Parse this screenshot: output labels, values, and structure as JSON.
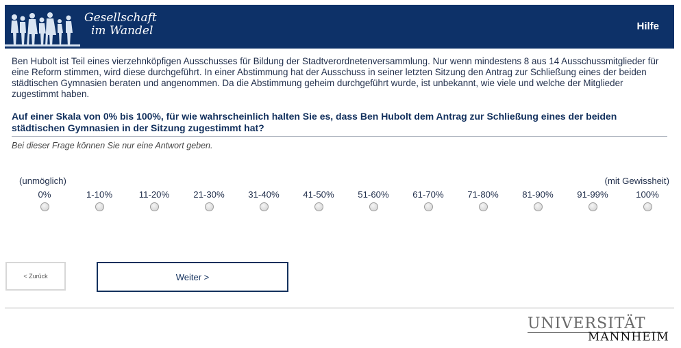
{
  "header": {
    "logo_title_line1": "Gesellschaft",
    "logo_title_line2": "im Wandel",
    "help_label": "Hilfe",
    "bg_color": "#0d3168"
  },
  "intro_text": "Ben Hubolt ist Teil eines vierzehnköpfigen Ausschusses für Bildung der Stadtverordnetenversammlung. Nur wenn mindestens 8 aus 14 Ausschussmitglieder für eine Reform stimmen, wird diese durchgeführt. In einer Abstimmung hat der Ausschuss in seiner letzten Sitzung den Antrag zur Schließung eines der beiden städtischen Gymnasien beraten und angenommen. Da die Abstimmung geheim durchgeführt wurde, ist unbekannt, wie viele und welche der Mitglieder zugestimmt haben.",
  "question": "Auf einer Skala von 0% bis 100%, für wie wahrscheinlich halten Sie es, dass Ben Hubolt dem Antrag zur Schließung eines der beiden städtischen Gymnasien in der Sitzung zugestimmt hat?",
  "hint": "Bei dieser Frage können Sie nur eine Antwort geben.",
  "scale": {
    "anchor_left": "(unmöglich)",
    "anchor_right": "(mit Gewissheit)",
    "options": [
      "0%",
      "1-10%",
      "11-20%",
      "21-30%",
      "31-40%",
      "41-50%",
      "51-60%",
      "61-70%",
      "71-80%",
      "81-90%",
      "91-99%",
      "100%"
    ]
  },
  "nav": {
    "back_label": "< Zurück",
    "next_label": "Weiter >"
  },
  "footer": {
    "uni_line1": "UNIVERSITÄT",
    "uni_line2": "MANNHEIM"
  }
}
